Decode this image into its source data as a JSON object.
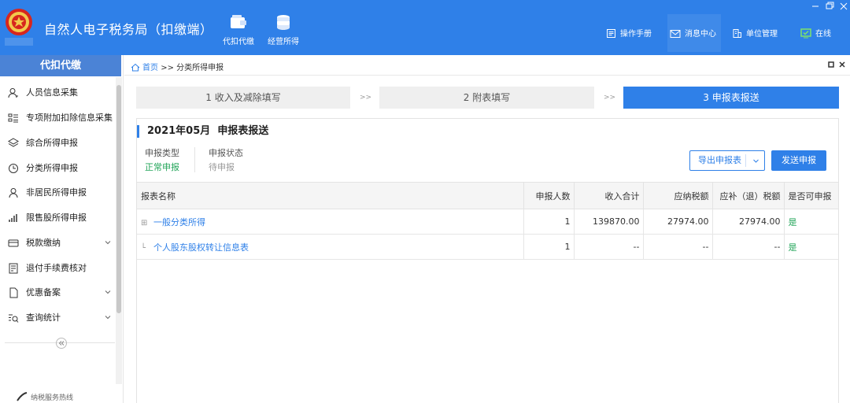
{
  "app": {
    "title": "自然人电子税务局（扣缴端）",
    "logo_text": "中国税务",
    "modules": [
      {
        "label": "代扣代缴",
        "icon": "wallet-icon"
      },
      {
        "label": "经营所得",
        "icon": "coins-icon"
      }
    ],
    "header_links": [
      {
        "label": "操作手册",
        "icon": "manual-icon"
      },
      {
        "label": "消息中心",
        "icon": "mail-icon"
      },
      {
        "label": "单位管理",
        "icon": "building-icon"
      },
      {
        "label": "在线",
        "icon": "online-icon"
      }
    ]
  },
  "sidebar": {
    "title": "代扣代缴",
    "items": [
      {
        "label": "人员信息采集",
        "icon": "person-icon"
      },
      {
        "label": "专项附加扣除信息采集",
        "icon": "list-icon"
      },
      {
        "label": "综合所得申报",
        "icon": "layers-icon"
      },
      {
        "label": "分类所得申报",
        "icon": "clock-icon"
      },
      {
        "label": "非居民所得申报",
        "icon": "person-outline-icon"
      },
      {
        "label": "限售股所得申报",
        "icon": "bar-chart-icon"
      },
      {
        "label": "税款缴纳",
        "icon": "card-icon"
      },
      {
        "label": "退付手续费核对",
        "icon": "receipt-icon"
      },
      {
        "label": "优惠备案",
        "icon": "document-icon"
      },
      {
        "label": "查询统计",
        "icon": "search-list-icon"
      }
    ],
    "hotline": "纳税服务热线"
  },
  "breadcrumb": {
    "home": "首页",
    "separator": ">>",
    "current": "分类所得申报"
  },
  "steps": [
    {
      "label": "1 收入及减除填写",
      "active": false
    },
    {
      "label": "2 附表填写",
      "active": false
    },
    {
      "label": "3 申报表报送",
      "active": true
    }
  ],
  "step_separator": ">>",
  "report": {
    "period": "2021年05月",
    "title": "申报表报送",
    "type_label": "申报类型",
    "type_value": "正常申报",
    "status_label": "申报状态",
    "status_value": "待申报",
    "export_button": "导出申报表",
    "send_button": "发送申报"
  },
  "table": {
    "columns": [
      "报表名称",
      "申报人数",
      "收入合计",
      "应纳税额",
      "应补（退）税额",
      "是否可申报"
    ],
    "rows": [
      {
        "tree": "⊞",
        "name": "一般分类所得",
        "people": "1",
        "income": "139870.00",
        "tax": "27974.00",
        "refund": "27974.00",
        "can_declare": "是"
      },
      {
        "tree": "└",
        "name": "个人股东股权转让信息表",
        "people": "1",
        "income": "--",
        "tax": "--",
        "refund": "--",
        "can_declare": "是"
      }
    ]
  },
  "colors": {
    "primary": "#2f80e8",
    "success": "#23a55a",
    "sidebar_header": "#4b83d6"
  }
}
